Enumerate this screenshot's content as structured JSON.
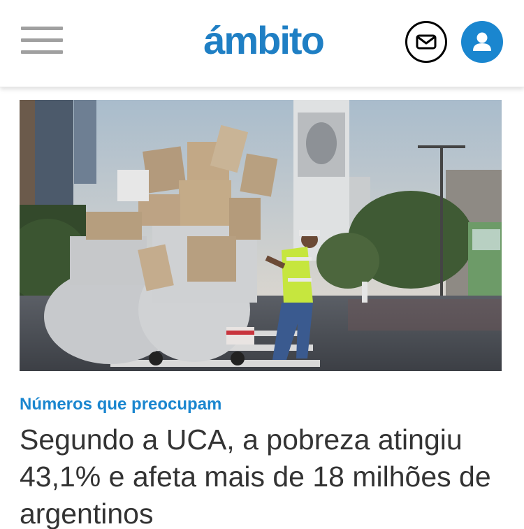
{
  "header": {
    "logo_text": "ámbito",
    "brand_color": "#1f7fc4",
    "menu_icon": "hamburger-menu-icon",
    "mail_icon": "envelope-icon",
    "user_icon": "user-icon"
  },
  "article": {
    "image_description_icon": "photo",
    "kicker": "Números que preocupam",
    "headline": "Segundo a UCA, a pobreza atingiu 43,1% e afeta mais de 18 milhões de argentinos",
    "kicker_color": "#1a86cf"
  }
}
